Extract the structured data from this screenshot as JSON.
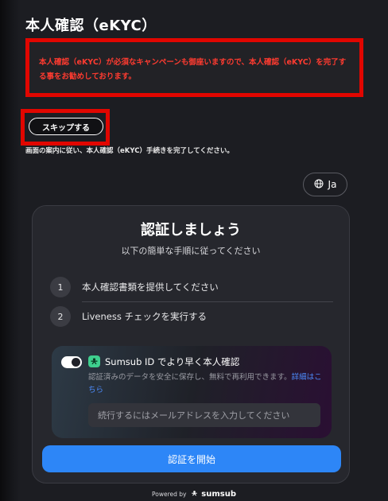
{
  "header": {
    "title": "本人確認（eKYC）"
  },
  "notice": {
    "text": "本人確認（eKYC）が必須なキャンペーンも御座いますので、本人確認（eKYC）を完了する事をお勧めしております。"
  },
  "actions": {
    "skip_label": "スキップする"
  },
  "instruction": {
    "text": "画面の案内に従い、本人確認（eKYC）手続きを完了してください。"
  },
  "language": {
    "label": "Ja",
    "icon": "globe-icon"
  },
  "card": {
    "title": "認証しましょう",
    "subtitle": "以下の簡単な手順に従ってください",
    "steps": [
      {
        "number": "1",
        "label": "本人確認書類を提供してください"
      },
      {
        "number": "2",
        "label": "Liveness チェックを実行する"
      }
    ],
    "sumsub": {
      "toggle_on": true,
      "heading": "Sumsub ID でより早く本人確認",
      "description": "認証済みのデータを安全に保存し、無料で再利用できます。",
      "link": "詳細はこちら",
      "email_placeholder": "続行するにはメールアドレスを入力してください",
      "accent_color": "#3ecf8e"
    },
    "start_label": "認証を開始",
    "start_color": "#2d86f7"
  },
  "footer": {
    "powered_by": "Powered by",
    "brand": "sumsub"
  },
  "colors": {
    "highlight_border": "#e10600",
    "notice_text": "#ff3b30",
    "link": "#4d8dff"
  }
}
